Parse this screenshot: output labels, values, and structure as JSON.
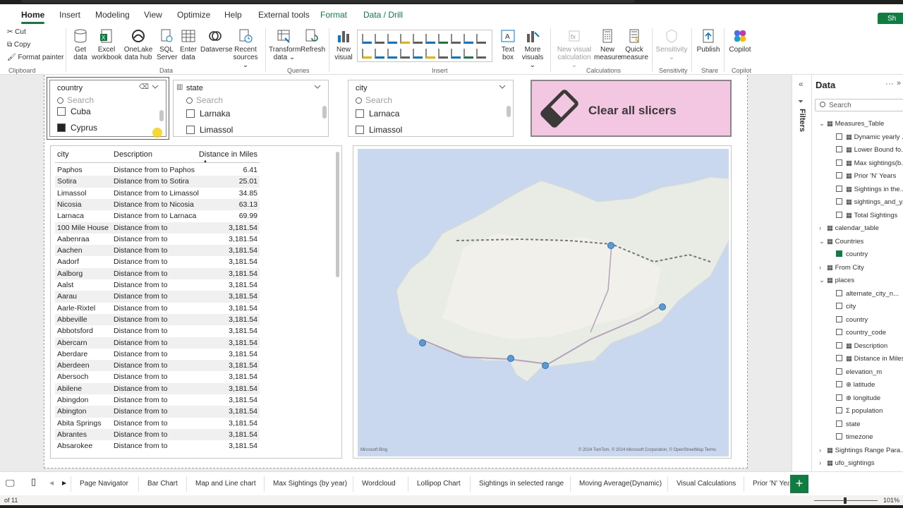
{
  "ribbon_tabs": [
    "Home",
    "Insert",
    "Modeling",
    "View",
    "Optimize",
    "Help",
    "External tools",
    "Format",
    "Data / Drill"
  ],
  "share_label": "Sh",
  "clipboard": {
    "cut": "Cut",
    "copy": "Copy",
    "format_painter": "Format painter",
    "group": "Clipboard"
  },
  "data_group": {
    "get_data": [
      "Get",
      "data"
    ],
    "excel": [
      "Excel",
      "workbook"
    ],
    "onelake": [
      "OneLake",
      "data hub"
    ],
    "sql": [
      "SQL",
      "Server"
    ],
    "enter": [
      "Enter",
      "data"
    ],
    "dataverse": [
      "Dataverse",
      ""
    ],
    "recent": [
      "Recent",
      "sources"
    ],
    "group": "Data"
  },
  "queries_group": {
    "transform": [
      "Transform",
      "data"
    ],
    "refresh": [
      "Refresh",
      ""
    ],
    "group": "Queries"
  },
  "insert_group": {
    "new_visual": [
      "New",
      "visual"
    ],
    "text_box": [
      "Text",
      "box"
    ],
    "more_visuals": [
      "More",
      "visuals"
    ],
    "group": "Insert"
  },
  "calc_group": {
    "new_visual_calc": [
      "New visual",
      "calculation"
    ],
    "new_measure": [
      "New",
      "measure"
    ],
    "quick_measure": [
      "Quick",
      "measure"
    ],
    "group": "Calculations"
  },
  "sensitivity_group": {
    "sensitivity": [
      "Sensitivity",
      ""
    ],
    "group": "Sensitivity"
  },
  "share_group": {
    "publish": [
      "Publish",
      ""
    ],
    "group": "Share"
  },
  "copilot_group": {
    "copilot": [
      "Copilot",
      ""
    ],
    "group": "Copilot"
  },
  "slicer_country": {
    "title": "country",
    "search": "Search",
    "options": [
      {
        "label": "Cuba",
        "checked": false
      },
      {
        "label": "Cyprus",
        "checked": true
      }
    ]
  },
  "slicer_state": {
    "title": "state",
    "search": "Search",
    "options": [
      {
        "label": "Larnaka",
        "checked": false
      },
      {
        "label": "Limassol",
        "checked": false
      }
    ]
  },
  "slicer_city": {
    "title": "city",
    "search": "Search",
    "options": [
      {
        "label": "Larnaca",
        "checked": false
      },
      {
        "label": "Limassol",
        "checked": false
      }
    ]
  },
  "clear_button": {
    "label": "Clear all slicers",
    "color": "#f3c6e1"
  },
  "table": {
    "columns": [
      "city",
      "Description",
      "Distance in Miles"
    ],
    "rows": [
      [
        "Paphos",
        "Distance from to Paphos",
        "6.41"
      ],
      [
        "Sotira",
        "Distance from to Sotira",
        "25.01"
      ],
      [
        "Limassol",
        "Distance from to Limassol",
        "34.85"
      ],
      [
        "Nicosia",
        "Distance from to Nicosia",
        "63.13"
      ],
      [
        "Larnaca",
        "Distance from to Larnaca",
        "69.99"
      ],
      [
        "100 Mile House",
        "Distance from to",
        "3,181.54"
      ],
      [
        "Aabenraa",
        "Distance from to",
        "3,181.54"
      ],
      [
        "Aachen",
        "Distance from to",
        "3,181.54"
      ],
      [
        "Aadorf",
        "Distance from to",
        "3,181.54"
      ],
      [
        "Aalborg",
        "Distance from to",
        "3,181.54"
      ],
      [
        "Aalst",
        "Distance from to",
        "3,181.54"
      ],
      [
        "Aarau",
        "Distance from to",
        "3,181.54"
      ],
      [
        "Aarle-Rixtel",
        "Distance from to",
        "3,181.54"
      ],
      [
        "Abbeville",
        "Distance from to",
        "3,181.54"
      ],
      [
        "Abbotsford",
        "Distance from to",
        "3,181.54"
      ],
      [
        "Abercarn",
        "Distance from to",
        "3,181.54"
      ],
      [
        "Aberdare",
        "Distance from to",
        "3,181.54"
      ],
      [
        "Aberdeen",
        "Distance from to",
        "3,181.54"
      ],
      [
        "Abersoch",
        "Distance from to",
        "3,181.54"
      ],
      [
        "Abilene",
        "Distance from to",
        "3,181.54"
      ],
      [
        "Abingdon",
        "Distance from to",
        "3,181.54"
      ],
      [
        "Abington",
        "Distance from to",
        "3,181.54"
      ],
      [
        "Abita Springs",
        "Distance from to",
        "3,181.54"
      ],
      [
        "Abrantes",
        "Distance from to",
        "3,181.54"
      ],
      [
        "Absarokee",
        "Distance from to",
        "3,181.54"
      ]
    ]
  },
  "map": {
    "attribution": "© 2024 TomTom, © 2024 Microsoft Corporation, © OpenStreetMap  Terms",
    "brand": "Microsoft Bing",
    "marker_color": "#5b9bd5"
  },
  "filters_label": "Filters",
  "data_pane": {
    "title": "Data",
    "search": "Search",
    "items": [
      {
        "label": "Measures_Table",
        "kind": "table",
        "twisty": "⌄",
        "indent": 0
      },
      {
        "label": "Dynamic yearly ...",
        "kind": "measure",
        "indent": 1
      },
      {
        "label": "Lower Bound fo...",
        "kind": "measure",
        "indent": 1
      },
      {
        "label": "Max sightings(b...",
        "kind": "measure",
        "indent": 1
      },
      {
        "label": "Prior 'N' Years",
        "kind": "measure",
        "indent": 1
      },
      {
        "label": "Sightings in the...",
        "kind": "measure",
        "indent": 1
      },
      {
        "label": "sightings_and_y...",
        "kind": "measure",
        "indent": 1
      },
      {
        "label": "Total Sightings",
        "kind": "measure",
        "indent": 1
      },
      {
        "label": "calendar_table",
        "kind": "table",
        "twisty": "›",
        "indent": 0
      },
      {
        "label": "Countries",
        "kind": "table",
        "twisty": "⌄",
        "indent": 0
      },
      {
        "label": "country",
        "kind": "checked",
        "indent": 1
      },
      {
        "label": "From City",
        "kind": "table",
        "twisty": "›",
        "indent": 0
      },
      {
        "label": "places",
        "kind": "table",
        "twisty": "⌄",
        "indent": 0
      },
      {
        "label": "alternate_city_n...",
        "kind": "field",
        "indent": 1
      },
      {
        "label": "city",
        "kind": "field",
        "indent": 1
      },
      {
        "label": "country",
        "kind": "field",
        "indent": 1
      },
      {
        "label": "country_code",
        "kind": "field",
        "indent": 1
      },
      {
        "label": "Description",
        "kind": "measure",
        "indent": 1
      },
      {
        "label": "Distance in Miles",
        "kind": "measure",
        "indent": 1
      },
      {
        "label": "elevation_m",
        "kind": "field",
        "indent": 1
      },
      {
        "label": "latitude",
        "kind": "globe",
        "indent": 1
      },
      {
        "label": "longitude",
        "kind": "globe",
        "indent": 1
      },
      {
        "label": "population",
        "kind": "sum",
        "indent": 1
      },
      {
        "label": "state",
        "kind": "field",
        "indent": 1
      },
      {
        "label": "timezone",
        "kind": "field",
        "indent": 1
      },
      {
        "label": "Sightings Range Para...",
        "kind": "table",
        "twisty": "›",
        "indent": 0
      },
      {
        "label": "ufo_sightings",
        "kind": "table",
        "twisty": "›",
        "indent": 0
      }
    ]
  },
  "page_tabs": [
    "Page Navigator",
    "Bar Chart",
    "Map and Line chart",
    "Max Sightings (by year)",
    "Wordcloud",
    "Lollipop Chart",
    "Sightings in selected range",
    "Moving Average(Dynamic)",
    "Visual Calculations",
    "Prior 'N' Years"
  ],
  "add_page": "+",
  "status": {
    "page": "of 11",
    "zoom": "101%"
  }
}
